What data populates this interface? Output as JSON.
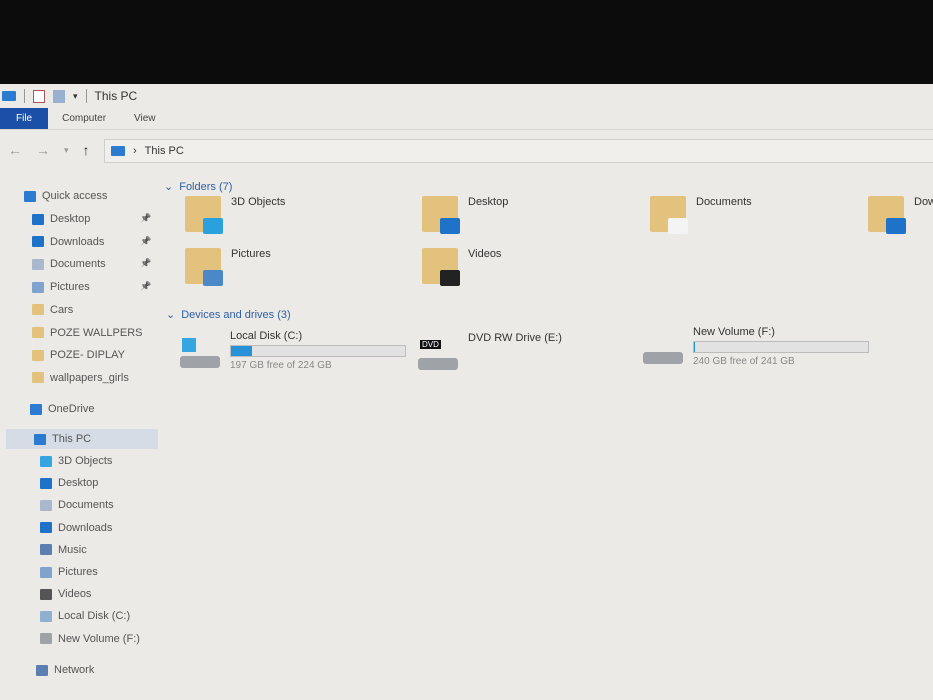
{
  "window": {
    "title": "This PC"
  },
  "ribbon": {
    "tabs": [
      "File",
      "Computer",
      "View"
    ]
  },
  "address": {
    "path": "This PC"
  },
  "sidebar": {
    "quick_access": "Quick access",
    "quick_items": [
      {
        "label": "Desktop",
        "pinned": true
      },
      {
        "label": "Downloads",
        "pinned": true
      },
      {
        "label": "Documents",
        "pinned": true
      },
      {
        "label": "Pictures",
        "pinned": true
      },
      {
        "label": "Cars"
      },
      {
        "label": "POZE  WALLPERS"
      },
      {
        "label": "POZE- DIPLAY"
      },
      {
        "label": "wallpapers_girls"
      }
    ],
    "onedrive": "OneDrive",
    "this_pc": "This PC",
    "pc_items": [
      "3D Objects",
      "Desktop",
      "Documents",
      "Downloads",
      "Music",
      "Pictures",
      "Videos",
      "Local Disk (C:)",
      "New Volume (F:)"
    ],
    "network": "Network"
  },
  "folders": {
    "header": "Folders (7)",
    "items": [
      "3D Objects",
      "Desktop",
      "Documents",
      "Downloads",
      "Pictures",
      "Videos"
    ]
  },
  "drives": {
    "header": "Devices and drives (3)",
    "items": [
      {
        "name": "Local Disk (C:)",
        "status": "197 GB free of 224 GB",
        "used_fraction": 0.12
      },
      {
        "name": "DVD RW Drive (E:)",
        "badge": "DVD"
      },
      {
        "name": "New Volume (F:)",
        "status": "240 GB free of 241 GB",
        "used_fraction": 0.004
      }
    ]
  },
  "colors": {
    "accent": "#1b4fa8",
    "bar": "#2792d8"
  }
}
